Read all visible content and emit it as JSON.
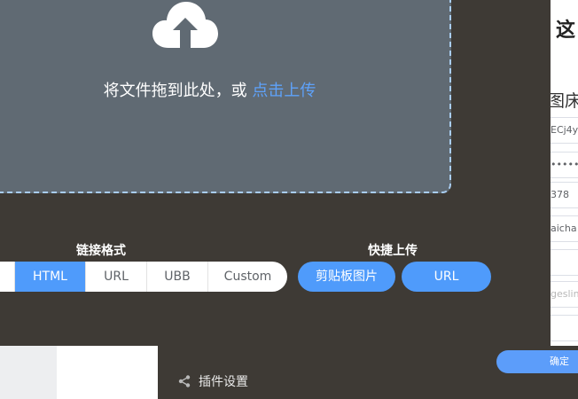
{
  "background": {
    "heading": "这",
    "subheading": "图床",
    "fields": [
      {
        "value": "ECj4y"
      },
      {
        "value": "••••••••"
      },
      {
        "value": "378"
      },
      {
        "value": "aicha"
      },
      {
        "value": ""
      },
      {
        "placeholder": "geslin"
      },
      {
        "value": ""
      }
    ],
    "confirm_label": "确定",
    "plugin_settings_label": "插件设置"
  },
  "upload": {
    "drop_text": "将文件拖到此处，或",
    "drop_link": "点击上传",
    "link_format_label": "链接格式",
    "link_formats": [
      {
        "label": "",
        "active": false
      },
      {
        "label": "HTML",
        "active": true
      },
      {
        "label": "URL",
        "active": false
      },
      {
        "label": "UBB",
        "active": false
      },
      {
        "label": "Custom",
        "active": false
      }
    ],
    "quick_upload_label": "快捷上传",
    "quick_buttons": [
      {
        "label": "剪贴板图片"
      },
      {
        "label": "URL"
      }
    ]
  },
  "colors": {
    "accent": "#4f9bfb",
    "modal_bg": "#3e3a35",
    "dropzone_bg": "#606a73"
  }
}
